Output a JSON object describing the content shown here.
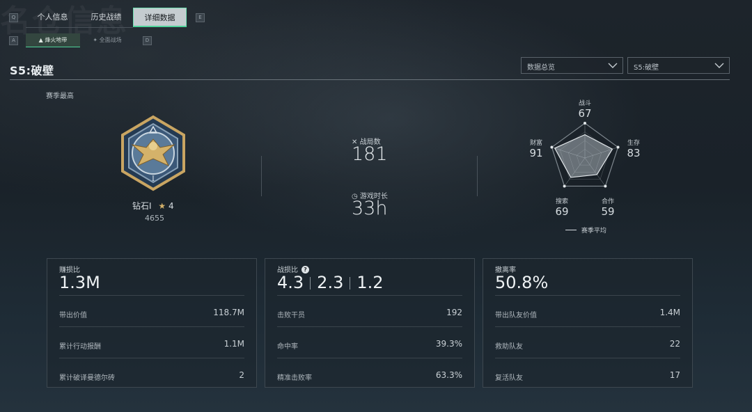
{
  "background_text": "名仓信息",
  "keys": {
    "left_tab": "Q",
    "right_tab": "E",
    "left_sub": "A",
    "right_sub": "D"
  },
  "tabs": [
    {
      "label": "个人信息",
      "active": false
    },
    {
      "label": "历史战绩",
      "active": false
    },
    {
      "label": "详细数据",
      "active": true
    }
  ],
  "subtabs": [
    {
      "label": "烽火地带",
      "icon": "beacon-icon",
      "active": true
    },
    {
      "label": "全面战场",
      "icon": "battlefield-icon",
      "active": false
    }
  ],
  "season_title": "S5:破壁",
  "filters": {
    "view": "数据总览",
    "season": "S5:破壁"
  },
  "rank": {
    "section_label": "赛季最高",
    "name": "钻石I",
    "stars": "4",
    "score": "4655"
  },
  "match_stats": {
    "matches_label": "战局数",
    "matches_value": "181",
    "time_label": "游戏时长",
    "time_value": "33h"
  },
  "radar": {
    "axes": [
      {
        "label": "战斗",
        "value": "67"
      },
      {
        "label": "生存",
        "value": "83"
      },
      {
        "label": "合作",
        "value": "59"
      },
      {
        "label": "搜索",
        "value": "69"
      },
      {
        "label": "财富",
        "value": "91"
      }
    ],
    "values": [
      67,
      83,
      59,
      69,
      91
    ],
    "average_values": [
      40,
      40,
      40,
      40,
      40
    ],
    "max": 100,
    "legend": "赛季平均"
  },
  "panels": [
    {
      "title": "赚损比",
      "big": "1.3M",
      "rows": [
        {
          "label": "带出价值",
          "value": "118.7M"
        },
        {
          "label": "累计行动报酬",
          "value": "1.1M"
        },
        {
          "label": "累计破译曼德尔砖",
          "value": "2"
        }
      ]
    },
    {
      "title": "战损比",
      "big_parts": [
        "4.3",
        "2.3",
        "1.2"
      ],
      "rows": [
        {
          "label": "击败干员",
          "value": "192"
        },
        {
          "label": "命中率",
          "value": "39.3%"
        },
        {
          "label": "精准击败率",
          "value": "63.3%"
        }
      ]
    },
    {
      "title": "撤离率",
      "big": "50.8%",
      "rows": [
        {
          "label": "带出队友价值",
          "value": "1.4M"
        },
        {
          "label": "救助队友",
          "value": "22"
        },
        {
          "label": "复活队友",
          "value": "17"
        }
      ]
    }
  ],
  "colors": {
    "accent": "#4fd39a",
    "gold": "#d4b26a",
    "medal_blue": "#2f4a66"
  }
}
